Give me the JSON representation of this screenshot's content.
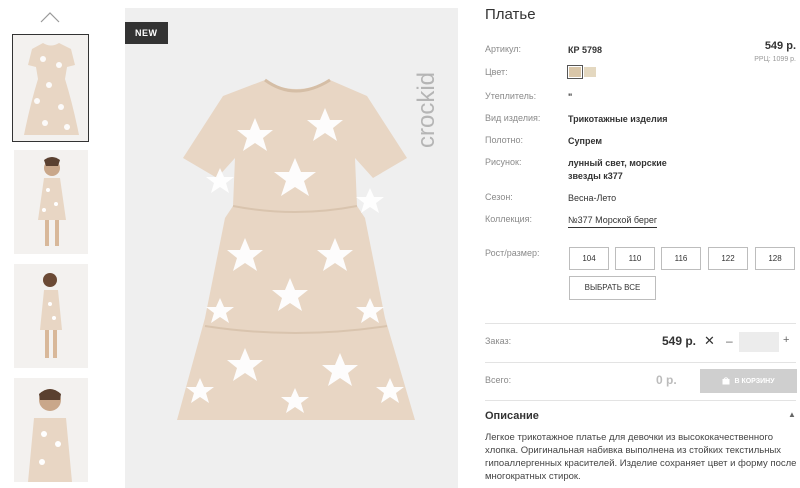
{
  "product": {
    "title": "Платье",
    "badge": "NEW",
    "brand": "crockid",
    "price": "549 р.",
    "rrp": "РРЦ: 1099 р."
  },
  "details": [
    {
      "label": "Артикул:",
      "value": "КР 5798"
    },
    {
      "label": "Цвет:",
      "value": ""
    },
    {
      "label": "Утеплитель:",
      "value": "\""
    },
    {
      "label": "Вид изделия:",
      "value": "Трикотажные изделия"
    },
    {
      "label": "Полотно:",
      "value": "Супрем"
    },
    {
      "label": "Рисунок:",
      "value": "лунный свет, морские звезды к377"
    },
    {
      "label": "Сезон:",
      "value": "Весна-Лето"
    },
    {
      "label": "Коллекция:",
      "value": "№377 Морской берег"
    }
  ],
  "colors": [
    "#d9c6a8",
    "#e4d8c0"
  ],
  "sizes": {
    "label": "Рост/размер:",
    "options": [
      "104",
      "110",
      "116",
      "122",
      "128"
    ],
    "select_all": "ВЫБРАТЬ ВСЕ"
  },
  "order": {
    "label": "Заказ:",
    "price": "549 р.",
    "times": "✕",
    "minus": "–",
    "plus": "+",
    "qty": ""
  },
  "total": {
    "label": "Всего:",
    "value": "0 р.",
    "cart_button": "В КОРЗИНУ"
  },
  "description": {
    "title": "Описание",
    "caret": "▲",
    "text": "Легкое трикотажное платье для девочки из высококачественного хлопка. Оригинальная набивка выполнена из стойких текстильных гипоаллергенных красителей. Изделие сохраняет цвет и форму после многократных стирок."
  },
  "theme": {
    "dress": "#e8d6c4",
    "star": "#ffffff"
  }
}
